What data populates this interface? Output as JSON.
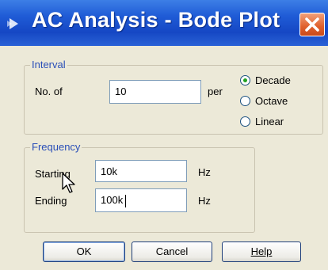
{
  "window": {
    "title": "AC Analysis - Bode Plot",
    "title_icon": "play-arrow-icon",
    "close_icon": "close-x-icon",
    "accent_color": "#1f5bd6",
    "close_color": "#e0602c"
  },
  "interval": {
    "group_title": "Interval",
    "count_label": "No. of",
    "count_value": "10",
    "per_label": "per",
    "options": [
      "Decade",
      "Octave",
      "Linear"
    ],
    "selected": "Decade"
  },
  "frequency": {
    "group_title": "Frequency",
    "starting_label": "Starting",
    "starting_value": "10k",
    "starting_unit": "Hz",
    "ending_label": "Ending",
    "ending_value": "100k",
    "ending_unit": "Hz"
  },
  "buttons": {
    "ok": "OK",
    "cancel": "Cancel",
    "help": "Help"
  }
}
